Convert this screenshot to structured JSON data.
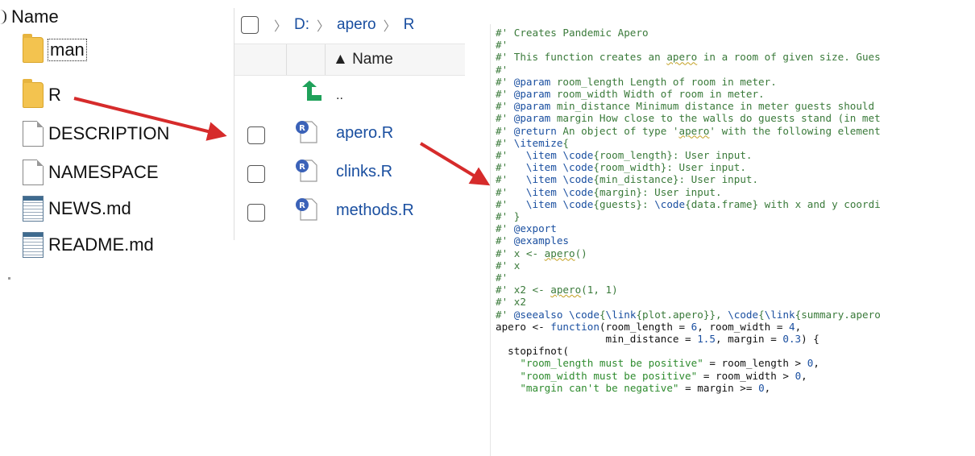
{
  "folder_tree": {
    "header": "Name",
    "items": [
      {
        "label": "man",
        "icon": "folder-icon"
      },
      {
        "label": "R",
        "icon": "folder-icon"
      },
      {
        "label": "DESCRIPTION",
        "icon": "file-icon"
      },
      {
        "label": "NAMESPACE",
        "icon": "file-icon"
      },
      {
        "label": "NEWS.md",
        "icon": "markdown-file-icon"
      },
      {
        "label": "README.md",
        "icon": "markdown-file-icon"
      }
    ]
  },
  "explorer": {
    "breadcrumb": [
      "D:",
      "apero",
      "R"
    ],
    "column_header": "▲ Name",
    "parent_label": "..",
    "files": [
      "apero.R",
      "clinks.R",
      "methods.R"
    ]
  },
  "code_lines": [
    [
      [
        "#' ",
        "c"
      ],
      [
        "Creates Pandemic Apero",
        "c"
      ]
    ],
    [
      [
        "#'",
        "c"
      ]
    ],
    [
      [
        "#' ",
        "c"
      ],
      [
        "This function creates an ",
        "c"
      ],
      [
        "apero",
        "cu"
      ],
      [
        " in a room of given size. Gues",
        "c"
      ]
    ],
    [
      [
        "#'",
        "c"
      ]
    ],
    [
      [
        "#' ",
        "c"
      ],
      [
        "@param",
        "t"
      ],
      [
        " room_length Length of room in meter.",
        "c"
      ]
    ],
    [
      [
        "#' ",
        "c"
      ],
      [
        "@param",
        "t"
      ],
      [
        " room_width Width of room in meter.",
        "c"
      ]
    ],
    [
      [
        "#' ",
        "c"
      ],
      [
        "@param",
        "t"
      ],
      [
        " min_distance Minimum distance in meter guests should",
        "c"
      ]
    ],
    [
      [
        "#' ",
        "c"
      ],
      [
        "@param",
        "t"
      ],
      [
        " margin How close to the walls do guests stand (in met",
        "c"
      ]
    ],
    [
      [
        "#' ",
        "c"
      ],
      [
        "@return",
        "t"
      ],
      [
        " An object of type '",
        "c"
      ],
      [
        "apero",
        "cu"
      ],
      [
        "' with the following element",
        "c"
      ]
    ],
    [
      [
        "#' ",
        "c"
      ],
      [
        "\\itemize",
        "t"
      ],
      [
        "{",
        "c"
      ]
    ],
    [
      [
        "#'   ",
        "c"
      ],
      [
        "\\item",
        "t"
      ],
      [
        " ",
        "c"
      ],
      [
        "\\code",
        "t"
      ],
      [
        "{room_length}: User input.",
        "c"
      ]
    ],
    [
      [
        "#'   ",
        "c"
      ],
      [
        "\\item",
        "t"
      ],
      [
        " ",
        "c"
      ],
      [
        "\\code",
        "t"
      ],
      [
        "{room_width}: User input.",
        "c"
      ]
    ],
    [
      [
        "#'   ",
        "c"
      ],
      [
        "\\item",
        "t"
      ],
      [
        " ",
        "c"
      ],
      [
        "\\code",
        "t"
      ],
      [
        "{min_distance}: User input.",
        "c"
      ]
    ],
    [
      [
        "#'   ",
        "c"
      ],
      [
        "\\item",
        "t"
      ],
      [
        " ",
        "c"
      ],
      [
        "\\code",
        "t"
      ],
      [
        "{margin}: User input.",
        "c"
      ]
    ],
    [
      [
        "#'   ",
        "c"
      ],
      [
        "\\item",
        "t"
      ],
      [
        " ",
        "c"
      ],
      [
        "\\code",
        "t"
      ],
      [
        "{guests}: ",
        "c"
      ],
      [
        "\\code",
        "t"
      ],
      [
        "{data.frame} with x and y coordi",
        "c"
      ]
    ],
    [
      [
        "#' }",
        "c"
      ]
    ],
    [
      [
        "#' ",
        "c"
      ],
      [
        "@export",
        "t"
      ]
    ],
    [
      [
        "#' ",
        "c"
      ],
      [
        "@examples",
        "t"
      ]
    ],
    [
      [
        "#' x <- ",
        "c"
      ],
      [
        "apero",
        "cu"
      ],
      [
        "()",
        "c"
      ]
    ],
    [
      [
        "#' x",
        "c"
      ]
    ],
    [
      [
        "#'",
        "c"
      ]
    ],
    [
      [
        "#' x2 <- ",
        "c"
      ],
      [
        "apero",
        "cu"
      ],
      [
        "(1, 1)",
        "c"
      ]
    ],
    [
      [
        "#' x2",
        "c"
      ]
    ],
    [
      [
        "#' ",
        "c"
      ],
      [
        "@seealso",
        "t"
      ],
      [
        " ",
        "c"
      ],
      [
        "\\code",
        "t"
      ],
      [
        "{",
        "c"
      ],
      [
        "\\link",
        "t"
      ],
      [
        "{plot.apero}}, ",
        "c"
      ],
      [
        "\\code",
        "t"
      ],
      [
        "{",
        "c"
      ],
      [
        "\\link",
        "t"
      ],
      [
        "{summary.apero",
        "c"
      ]
    ],
    [
      [
        "apero <- ",
        "p"
      ],
      [
        "function",
        "k"
      ],
      [
        "(room_length = ",
        "p"
      ],
      [
        "6",
        "n"
      ],
      [
        ", room_width = ",
        "p"
      ],
      [
        "4",
        "n"
      ],
      [
        ",",
        "p"
      ]
    ],
    [
      [
        "                  min_distance = ",
        "p"
      ],
      [
        "1.5",
        "n"
      ],
      [
        ", margin = ",
        "p"
      ],
      [
        "0.3",
        "n"
      ],
      [
        ") {",
        "p"
      ]
    ],
    [
      [
        "  stopifnot(",
        "p"
      ]
    ],
    [
      [
        "    ",
        "p"
      ],
      [
        "\"room_length must be positive\"",
        "s"
      ],
      [
        " = room_length > ",
        "p"
      ],
      [
        "0",
        "n"
      ],
      [
        ",",
        "p"
      ]
    ],
    [
      [
        "    ",
        "p"
      ],
      [
        "\"room_width must be positive\"",
        "s"
      ],
      [
        " = room_width > ",
        "p"
      ],
      [
        "0",
        "n"
      ],
      [
        ",",
        "p"
      ]
    ],
    [
      [
        "    ",
        "p"
      ],
      [
        "\"margin can't be negative\"",
        "s"
      ],
      [
        " = margin >= ",
        "p"
      ],
      [
        "0",
        "n"
      ],
      [
        ",",
        "p"
      ]
    ]
  ],
  "colors": {
    "comment": "#3a7a3a",
    "roxygen_tag": "#1a4fa0",
    "string": "#2e8b2e",
    "arrow": "#d62b2b",
    "folder": "#f3c34f",
    "r_file_badge": "#3b62b8",
    "parent_arrow": "#1fa15a"
  }
}
